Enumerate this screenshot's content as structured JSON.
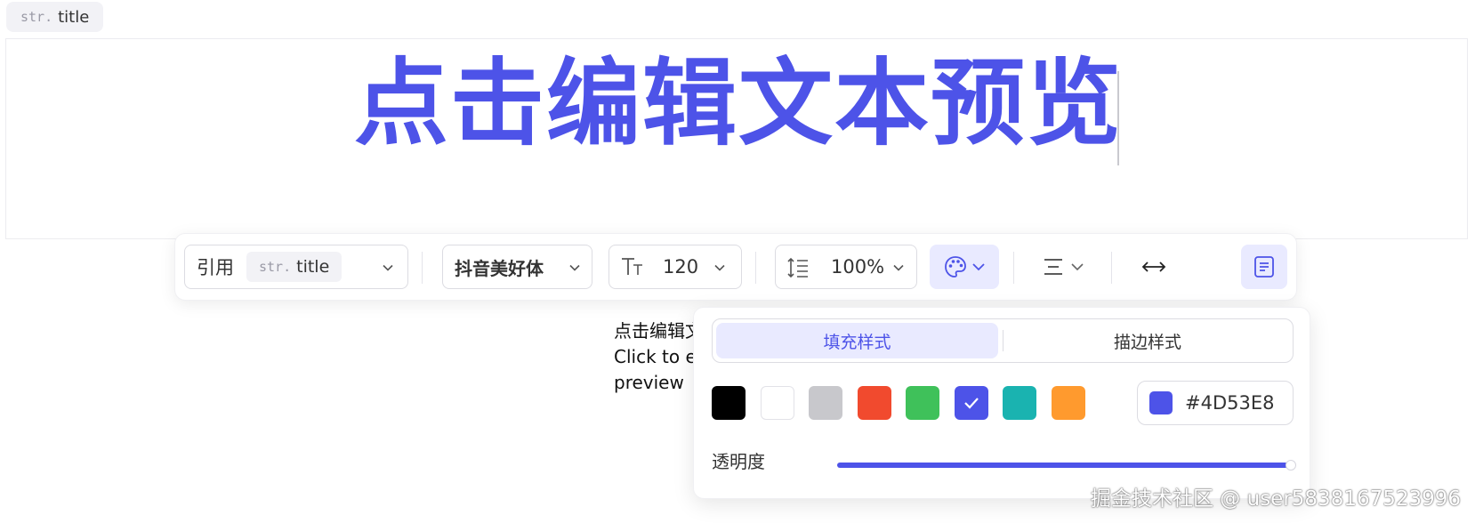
{
  "param_tag": {
    "type": "str.",
    "name": "title"
  },
  "canvas": {
    "text": "点击编辑文本预览",
    "color": "#4D53E8"
  },
  "toolbar": {
    "reference": {
      "label": "引用",
      "chip_type": "str.",
      "chip_name": "title"
    },
    "font": {
      "value": "抖音美好体"
    },
    "font_size": {
      "value": "120"
    },
    "line_height": {
      "value": "100%"
    },
    "icons": {
      "color": "palette-icon",
      "align": "align-center-icon",
      "width": "arrows-horizontal-icon",
      "text_layout": "text-block-icon"
    }
  },
  "color_panel": {
    "tabs": [
      {
        "label": "填充样式",
        "active": true
      },
      {
        "label": "描边样式",
        "active": false
      }
    ],
    "swatches": [
      "#000000",
      "#FFFFFF",
      "#C8C8CC",
      "#F14A2E",
      "#3FC15A",
      "#4D53E8",
      "#1AB3B0",
      "#FF9A2E"
    ],
    "selected_index": 5,
    "hex_value": "#4D53E8",
    "opacity_label": "透明度",
    "opacity": 1.0
  },
  "preview_ghost": {
    "line1": "点击编辑文",
    "line2": "Click to e",
    "line3": "preview"
  },
  "watermark": "掘金技术社区 @ user5838167523996"
}
